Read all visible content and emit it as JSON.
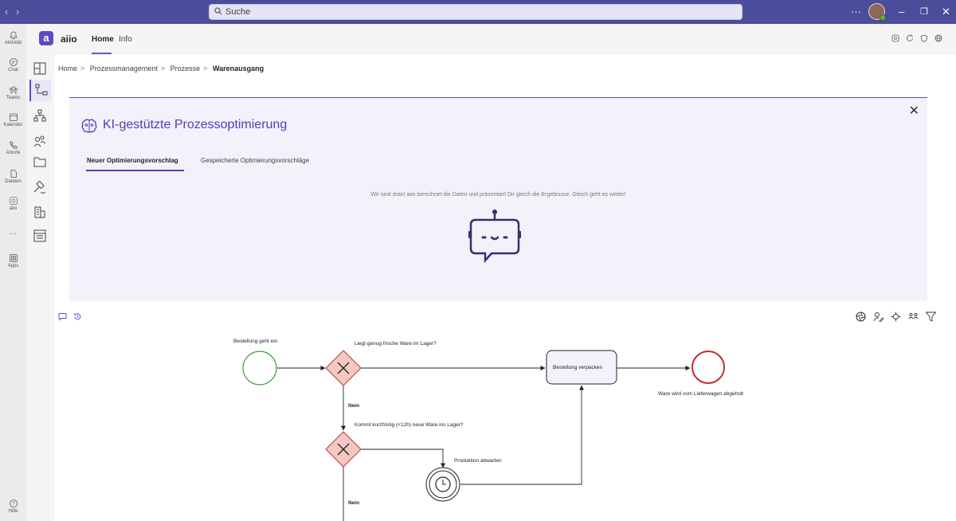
{
  "titlebar": {
    "search_placeholder": "Suche",
    "more": "···",
    "minimize": "–",
    "maximize": "❐",
    "close": "✕"
  },
  "rail": {
    "items": [
      {
        "label": "Aktivität",
        "icon": "bell-icon"
      },
      {
        "label": "Chat",
        "icon": "chat-icon"
      },
      {
        "label": "Teams",
        "icon": "teams-icon"
      },
      {
        "label": "Kalender",
        "icon": "calendar-icon"
      },
      {
        "label": "Anrufe",
        "icon": "phone-icon"
      },
      {
        "label": "Dateien",
        "icon": "file-icon"
      },
      {
        "label": "aiio",
        "icon": "aiio-icon"
      },
      {
        "label": "···",
        "icon": "more-icon"
      },
      {
        "label": "Apps",
        "icon": "apps-icon"
      },
      {
        "label": "Hilfe",
        "icon": "help-icon"
      }
    ]
  },
  "app": {
    "logo_letter": "a",
    "name": "aiio",
    "tabs": [
      "Home",
      "Info"
    ]
  },
  "breadcrumb": {
    "items": [
      "Home",
      "Prozessmanagement",
      "Prozesse"
    ],
    "current": "Warenausgang"
  },
  "ai_panel": {
    "title": "KI-gestützte Prozessoptimierung",
    "tabs": [
      "Neuer Optimierungsvorschlag",
      "Gespeicherte Optimierungsvorschläge"
    ],
    "message": "Wir sind dran! aiio berechnet die Daten und präsentiert Dir gleich die Ergebnisse. Gleich geht es weiter!",
    "close": "✕"
  },
  "diagram": {
    "start_label": "Bestellung geht ein",
    "gateway1_question": "Liegt genug frische Ware im Lager?",
    "task_label": "Bestellung verpacken",
    "end_label": "Ware wird vom Lieferwagen abgeholt",
    "no_label_1": "Nein",
    "gateway2_question": "Kommt kurzfristig (<12h) neue Ware ins Lager?",
    "timer_label": "Produktion abwarten",
    "no_label_2": "Nein"
  },
  "colors": {
    "titlebar": "#4b4d9b",
    "accent": "#5b4bc4",
    "start_event": "#3a9a3a",
    "end_event": "#c42b2b",
    "gateway_fill": "#f4c7c3"
  }
}
